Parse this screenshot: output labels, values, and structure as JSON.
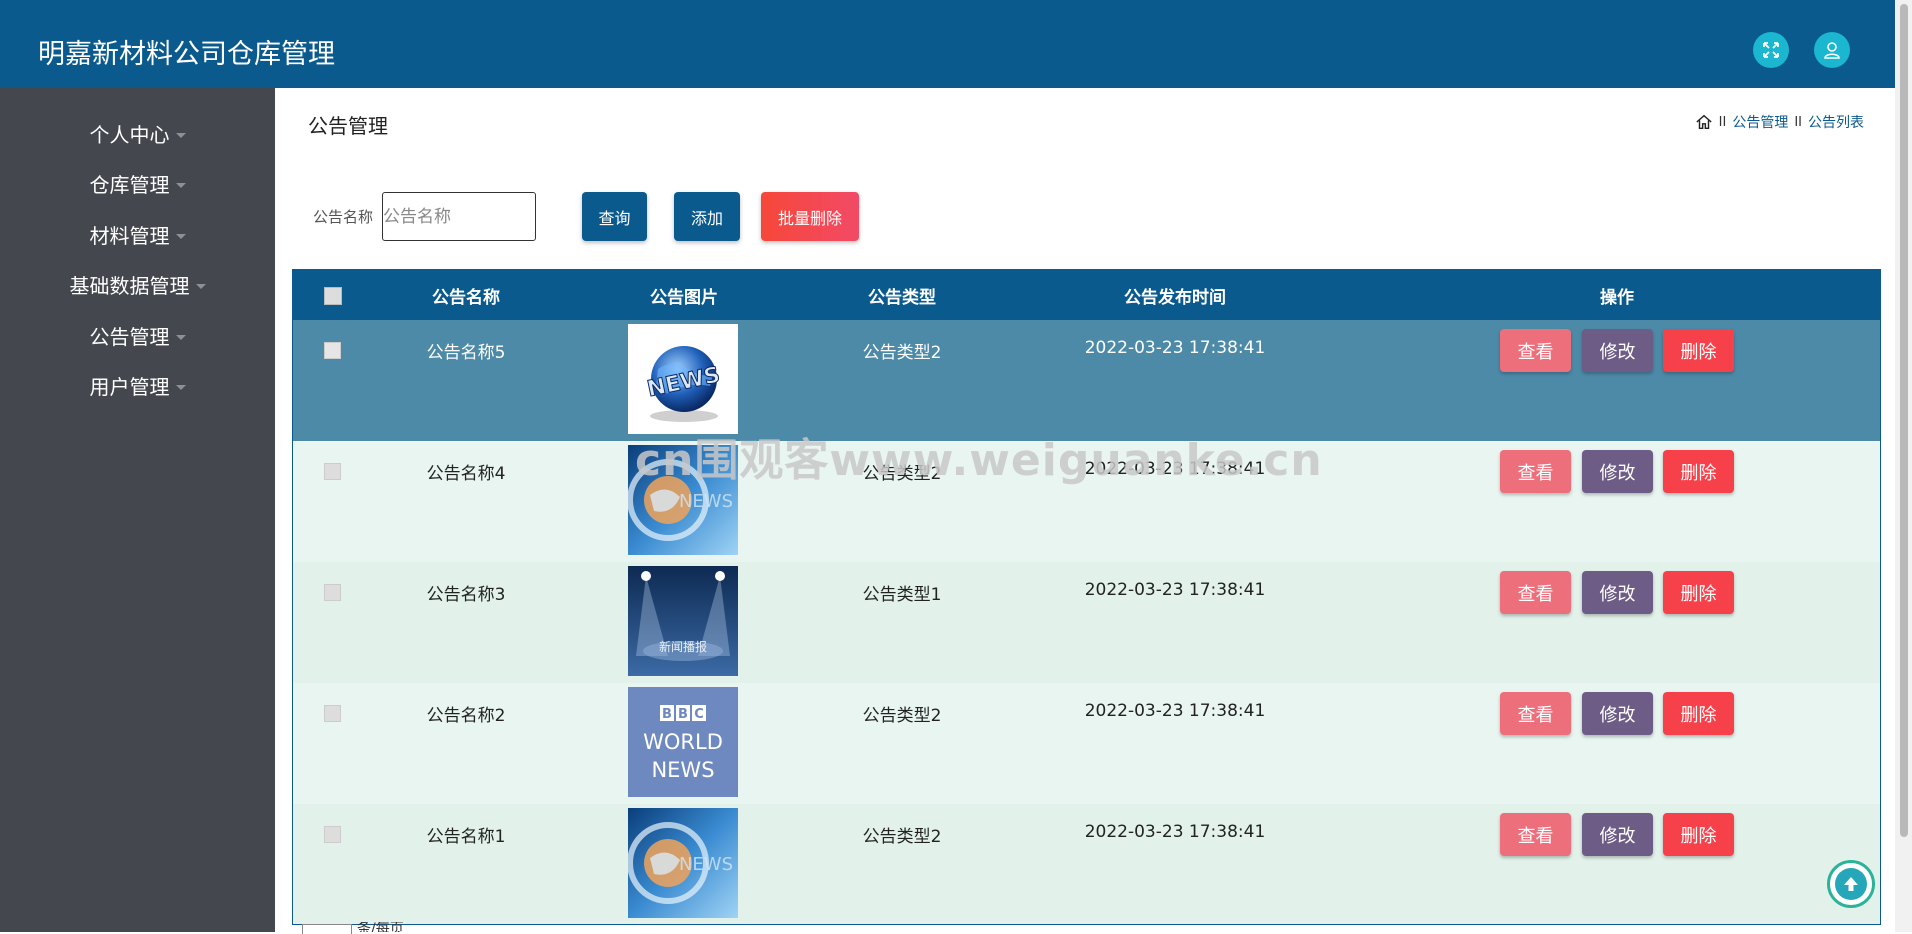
{
  "app": {
    "title": "明嘉新材料公司仓库管理"
  },
  "header": {
    "fullscreen_icon": "expand-icon",
    "user_icon": "user-icon",
    "accent": "#1bb6cf",
    "bg": "#0b5a8e"
  },
  "sidebar": {
    "items": [
      {
        "label": "个人中心"
      },
      {
        "label": "仓库管理"
      },
      {
        "label": "材料管理"
      },
      {
        "label": "基础数据管理"
      },
      {
        "label": "公告管理"
      },
      {
        "label": "用户管理"
      }
    ]
  },
  "main": {
    "page_title": "公告管理",
    "breadcrumb": [
      "公告管理",
      "公告列表"
    ],
    "search": {
      "label": "公告名称",
      "placeholder": "公告名称",
      "value": ""
    },
    "buttons": {
      "query": "查询",
      "add": "添加",
      "batch_delete": "批量删除"
    }
  },
  "table": {
    "headers": [
      "公告名称",
      "公告图片",
      "公告类型",
      "公告发布时间",
      "操作"
    ],
    "actions": {
      "view": "查看",
      "edit": "修改",
      "delete": "删除"
    },
    "rows": [
      {
        "name": "公告名称5",
        "type": "公告类型2",
        "time": "2022-03-23 17:38:41",
        "image": "news-globe",
        "selected": true
      },
      {
        "name": "公告名称4",
        "type": "公告类型2",
        "time": "2022-03-23 17:38:41",
        "image": "news-blue"
      },
      {
        "name": "公告名称3",
        "type": "公告类型1",
        "time": "2022-03-23 17:38:41",
        "image": "news-stage"
      },
      {
        "name": "公告名称2",
        "type": "公告类型2",
        "time": "2022-03-23 17:38:41",
        "image": "bbc-world-news"
      },
      {
        "name": "公告名称1",
        "type": "公告类型2",
        "time": "2022-03-23 17:38:41",
        "image": "news-blue"
      }
    ]
  },
  "images": {
    "stage_caption": "新闻播报",
    "bbc": [
      "BBC",
      "WORLD",
      "NEWS"
    ],
    "news_word": "NEWS"
  },
  "watermark": "cn围观客www.weiguanke.cn",
  "pager": {
    "text": "条/每页"
  }
}
